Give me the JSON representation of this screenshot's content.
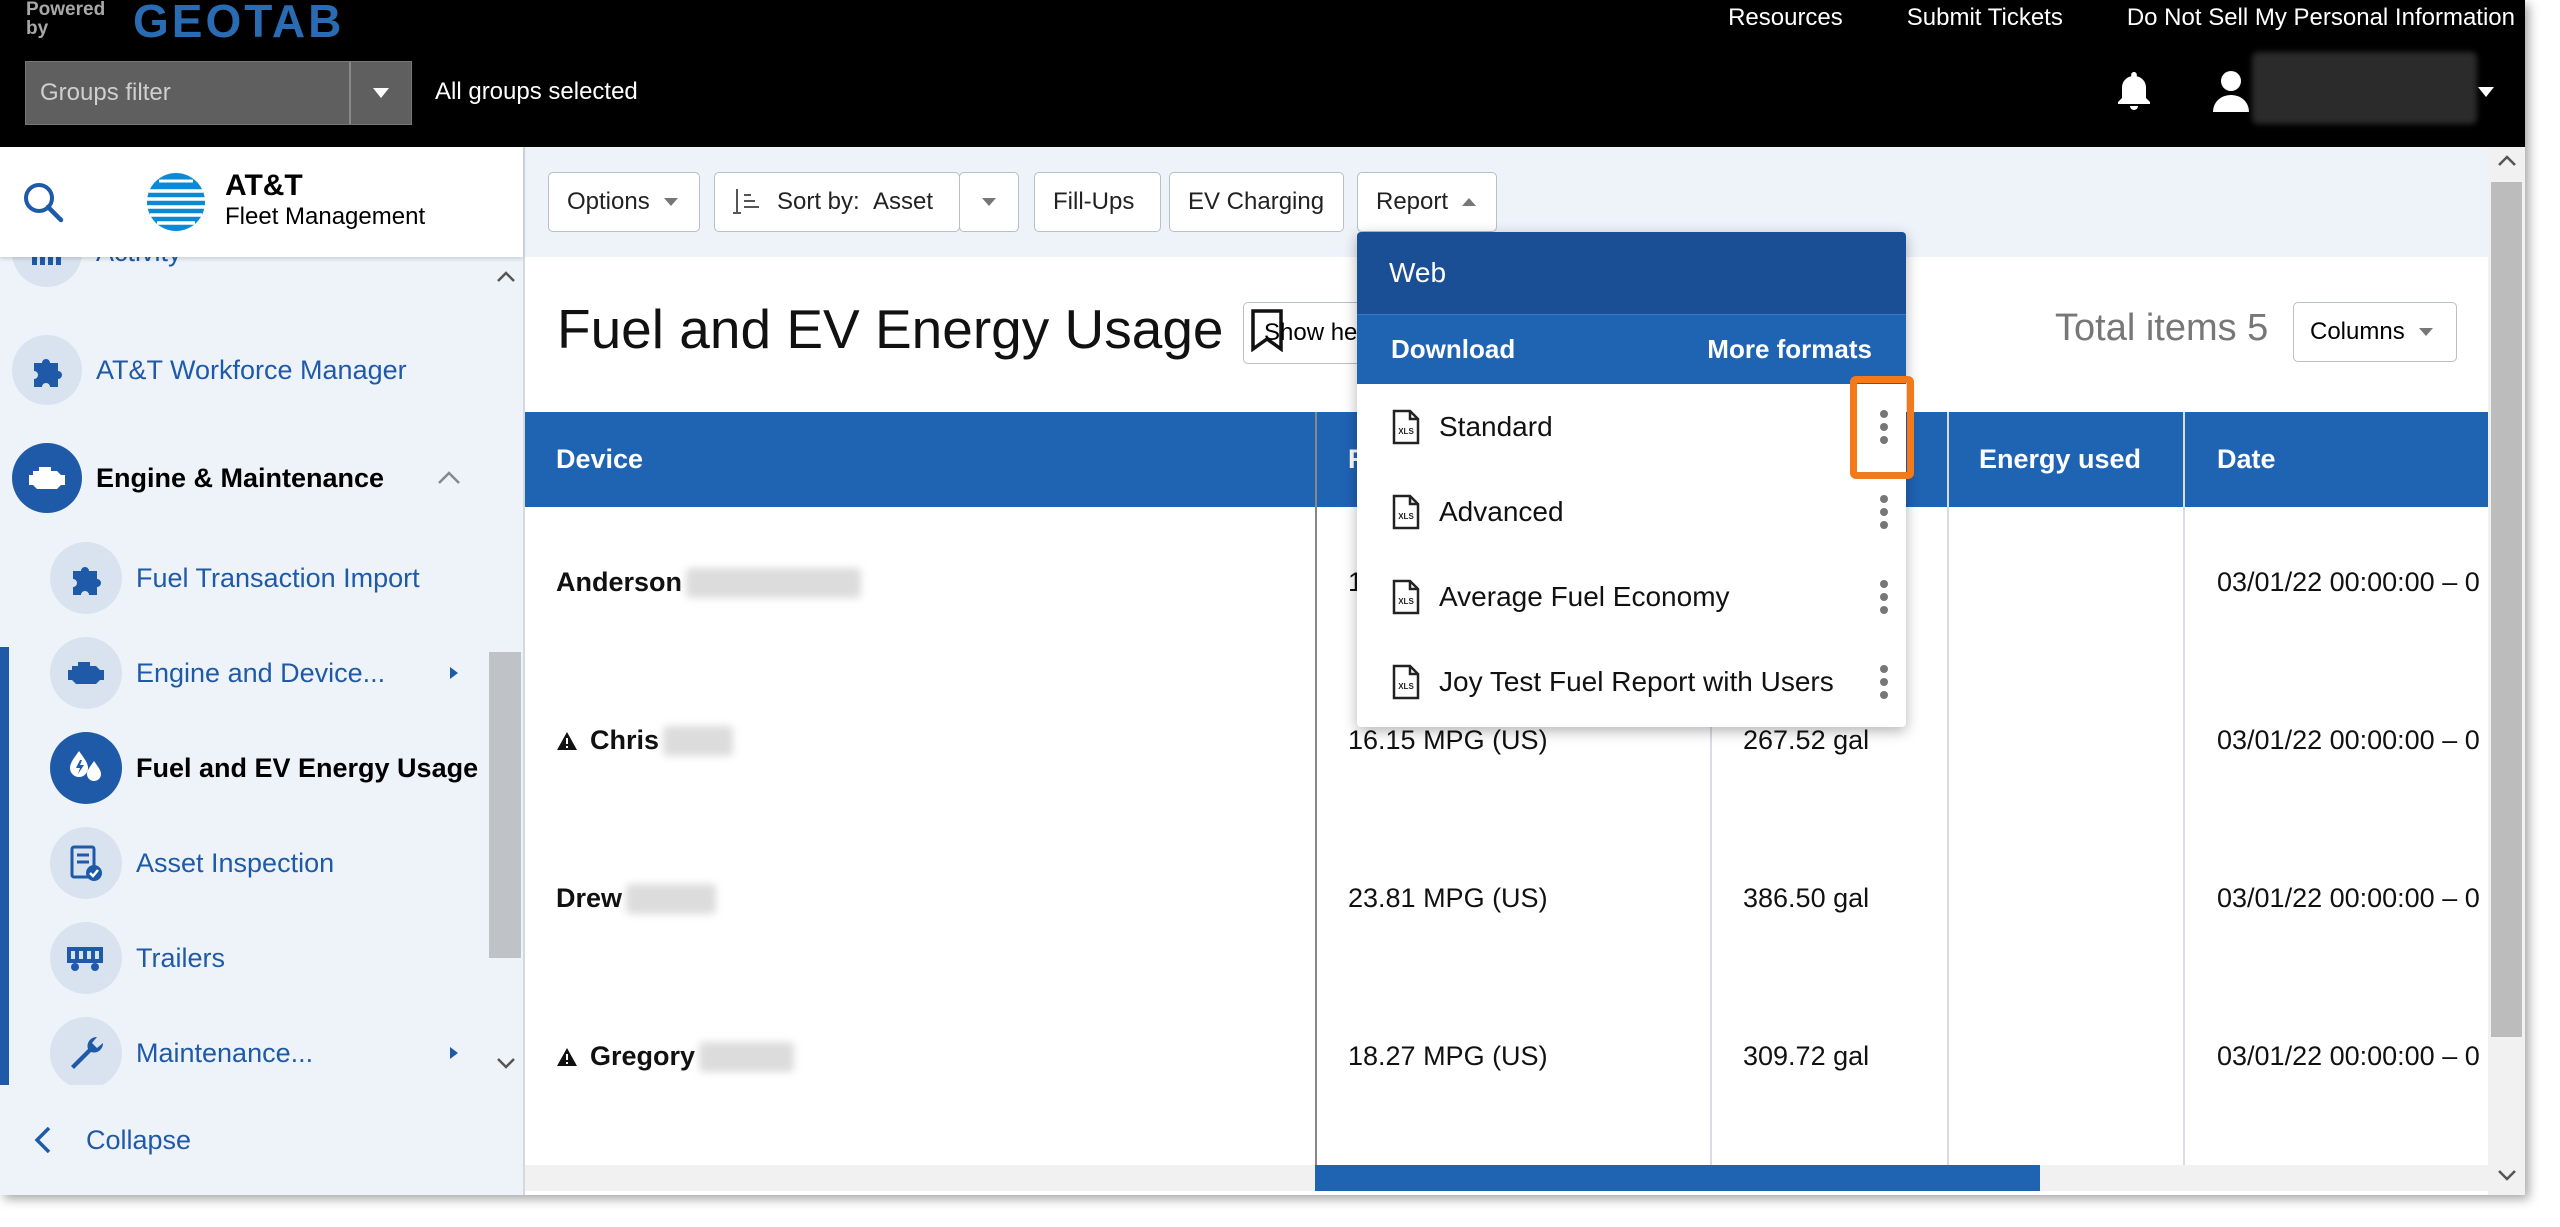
{
  "topbar": {
    "powered_by": "Powered by",
    "brand": "GEOTAB",
    "links": [
      "Resources",
      "Submit Tickets",
      "Do Not Sell My Personal Information"
    ],
    "groups_filter_placeholder": "Groups filter",
    "groups_status": "All groups selected"
  },
  "sidebar": {
    "app_name": "AT&T",
    "app_sub": "Fleet Management",
    "items": [
      {
        "label": "Activity"
      },
      {
        "label": "AT&T Workforce Manager"
      },
      {
        "label": "Engine & Maintenance"
      }
    ],
    "subitems": [
      {
        "label": "Fuel Transaction Import"
      },
      {
        "label": "Engine and Device..."
      },
      {
        "label": "Fuel and EV Energy Usage"
      },
      {
        "label": "Asset Inspection"
      },
      {
        "label": "Trailers"
      },
      {
        "label": "Maintenance..."
      }
    ],
    "collapse": "Collapse"
  },
  "toolbar": {
    "options": "Options",
    "sort_by": "Sort by:",
    "sort_value": "Asset",
    "fillups": "Fill-Ups",
    "ev_charging": "EV Charging",
    "report": "Report"
  },
  "page": {
    "title": "Fuel and EV Energy Usage",
    "show_btn": "Show he",
    "total_items": "Total items 5",
    "columns": "Columns"
  },
  "table": {
    "headers": [
      "Device",
      "F",
      "Energy used",
      "Date"
    ],
    "rows": [
      {
        "device": "Anderson",
        "warn": false,
        "economy": "1",
        "fuel": "",
        "date": "03/01/22 00:00:00 – 0"
      },
      {
        "device": "Chris",
        "warn": true,
        "economy": "16.15 MPG (US)",
        "fuel": "267.52 gal",
        "date": "03/01/22 00:00:00 – 0"
      },
      {
        "device": "Drew",
        "warn": false,
        "economy": "23.81 MPG (US)",
        "fuel": "386.50 gal",
        "date": "03/01/22 00:00:00 – 0"
      },
      {
        "device": "Gregory",
        "warn": true,
        "economy": "18.27 MPG (US)",
        "fuel": "309.72 gal",
        "date": "03/01/22 00:00:00 – 0"
      }
    ]
  },
  "report_menu": {
    "web": "Web",
    "download": "Download",
    "more_formats": "More formats",
    "items": [
      "Standard",
      "Advanced",
      "Average Fuel Economy",
      "Joy Test Fuel Report with Users"
    ],
    "file_badge": "XLS"
  },
  "colors": {
    "brand_blue": "#1f63b3",
    "highlight": "#f27a1a"
  }
}
